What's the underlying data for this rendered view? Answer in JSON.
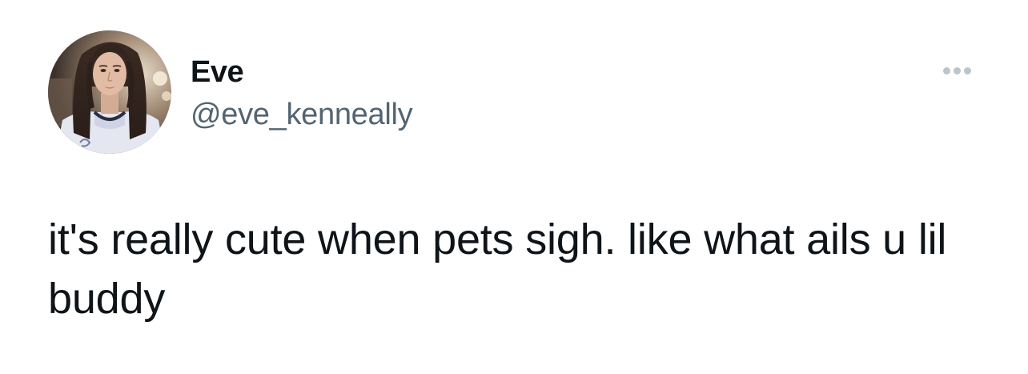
{
  "tweet": {
    "author": {
      "display_name": "Eve",
      "handle": "@eve_kenneally",
      "avatar_icon": "profile-photo"
    },
    "more_icon": "more-horizontal-icon",
    "text": "it's really cute when pets sigh. like what ails u lil buddy"
  },
  "colors": {
    "text_primary": "#0f1419",
    "text_secondary": "#536471",
    "more_dots": "#bcc4cc",
    "background": "#ffffff"
  }
}
